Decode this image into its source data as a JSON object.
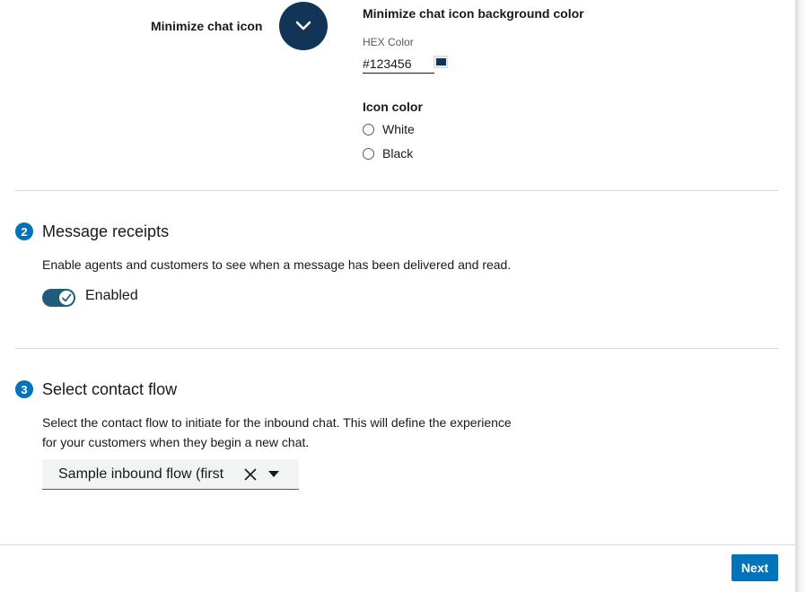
{
  "minimize": {
    "label": "Minimize chat icon",
    "icon": "chevron-down-icon",
    "bg_color_title": "Minimize chat icon background color",
    "hex_label": "HEX Color",
    "hex_value": "#123456",
    "icon_color_title": "Icon color",
    "icon_color_options": [
      "White",
      "Black"
    ]
  },
  "receipts": {
    "step": "2",
    "title": "Message receipts",
    "description": "Enable agents and customers to see when a message has been delivered and read.",
    "toggle_label": "Enabled",
    "toggle_on": true
  },
  "flow": {
    "step": "3",
    "title": "Select contact flow",
    "description_line1": "Select the contact flow to initiate for the inbound chat. This will define the experience",
    "description_line2": "for your customers when they begin a new chat.",
    "selected": "Sample inbound flow (first"
  },
  "footer": {
    "next_label": "Next"
  },
  "colors": {
    "accent": "#0073bb",
    "chat_icon_bg": "#123456",
    "toggle_on": "#1f5d7b"
  }
}
